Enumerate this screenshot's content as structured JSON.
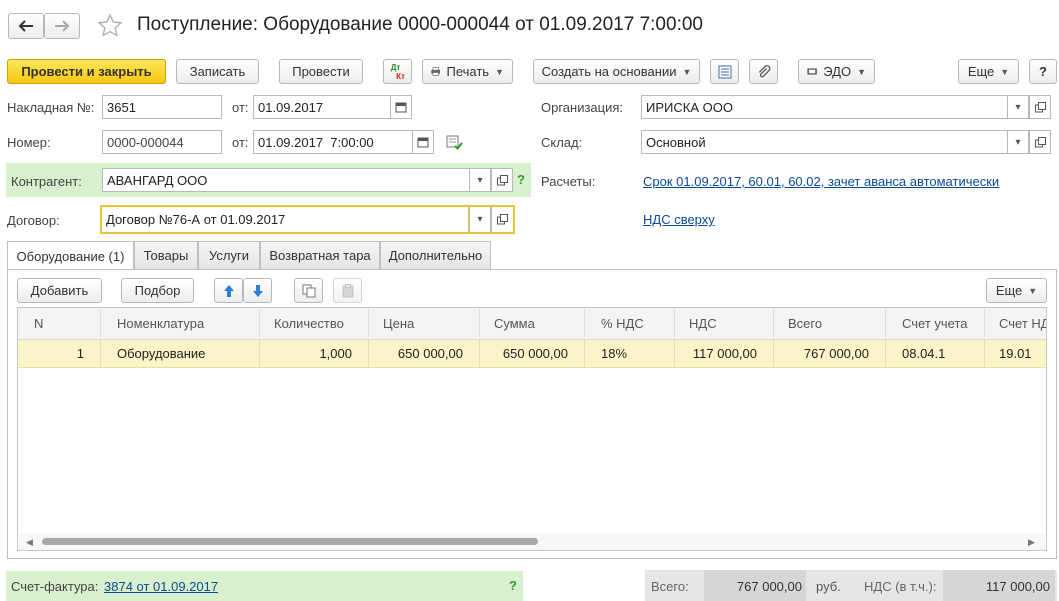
{
  "window": {
    "title": "Поступление: Оборудование 0000-000044 от 01.09.2017 7:00:00"
  },
  "toolbar": {
    "post_and_close": "Провести и закрыть",
    "save": "Записать",
    "post": "Провести",
    "dt_kt_top": "Дт",
    "dt_kt_bottom": "Кт",
    "print": "Печать",
    "create_based_on": "Создать на основании",
    "edo": "ЭДО",
    "more": "Еще",
    "help": "?"
  },
  "header": {
    "invoice_label": "Накладная №:",
    "invoice_number": "3651",
    "invoice_from_label": "от:",
    "invoice_date": "01.09.2017",
    "number_label": "Номер:",
    "number_value": "0000-000044",
    "number_from_label": "от:",
    "number_datetime": "01.09.2017  7:00:00",
    "organization_label": "Организация:",
    "organization_value": "ИРИСКА ООО",
    "warehouse_label": "Склад:",
    "warehouse_value": "Основной",
    "counterparty_label": "Контрагент:",
    "counterparty_value": "АВАНГАРД ООО",
    "counterparty_help": "?",
    "settlements_label": "Расчеты:",
    "settlements_link": "Срок 01.09.2017, 60.01, 60.02, зачет аванса автоматически",
    "contract_label": "Договор:",
    "contract_value": "Договор №76-А от 01.09.2017",
    "vat_link": "НДС сверху"
  },
  "tabs": [
    {
      "label": "Оборудование (1)",
      "active": true
    },
    {
      "label": "Товары",
      "active": false
    },
    {
      "label": "Услуги",
      "active": false
    },
    {
      "label": "Возвратная тара",
      "active": false
    },
    {
      "label": "Дополнительно",
      "active": false
    }
  ],
  "table_toolbar": {
    "add": "Добавить",
    "select": "Подбор",
    "more": "Еще"
  },
  "table": {
    "columns": [
      "N",
      "Номенклатура",
      "Количество",
      "Цена",
      "Сумма",
      "% НДС",
      "НДС",
      "Всего",
      "Счет учета",
      "Счет НДС"
    ],
    "rows": [
      [
        "1",
        "Оборудование",
        "1,000",
        "650 000,00",
        "650 000,00",
        "18%",
        "117 000,00",
        "767 000,00",
        "08.04.1",
        "19.01"
      ]
    ]
  },
  "footer": {
    "invoice_label": "Счет-фактура:",
    "invoice_link": "3874 от 01.09.2017",
    "invoice_help": "?",
    "total_label": "Всего:",
    "total_value": "767 000,00",
    "currency": "руб.",
    "vat_label": "НДС (в т.ч.):",
    "vat_value": "117 000,00"
  },
  "colors": {
    "primary_button": "#f5c712",
    "green_highlight": "#d9f0cf",
    "selected_row": "#fbf4c8",
    "link": "#0b4a94"
  }
}
